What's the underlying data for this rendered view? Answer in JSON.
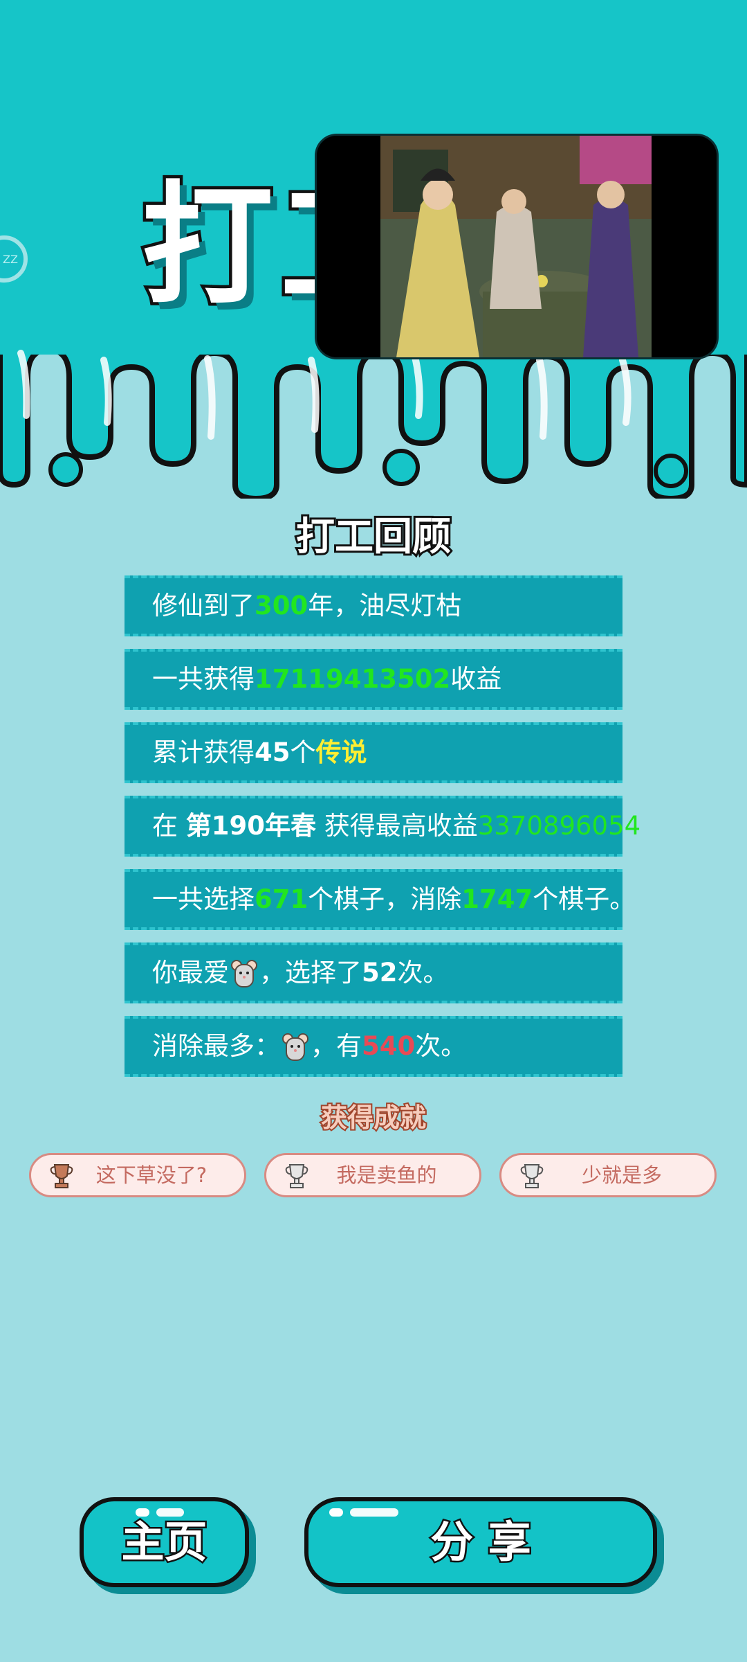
{
  "header": {
    "big_title": "打工",
    "side_bubble_text": "ZZ"
  },
  "review": {
    "title": "打工回顾",
    "rows": [
      {
        "pre": "修仙到了",
        "value": "300",
        "post": "年，油尽灯枯"
      },
      {
        "pre": "一共获得",
        "value": "17119413502",
        "post": "收益"
      },
      {
        "pre": "累计获得",
        "value": "45",
        "mid": "个",
        "highlight": "传说"
      },
      {
        "pre": "在 ",
        "bold": "第190年春",
        "mid": " 获得最高收益",
        "value": "3370896054"
      },
      {
        "pre": "一共选择",
        "value": "671",
        "mid": "个棋子，消除",
        "value2": "1747",
        "post": "个棋子。"
      },
      {
        "pre": "你最爱",
        "icon": "mouse-icon",
        "mid": "，选择了",
        "value": "52",
        "post": "次。"
      },
      {
        "pre": "消除最多：",
        "icon": "mouse-icon",
        "mid": "，有",
        "value": "540",
        "post": "次。"
      }
    ]
  },
  "achievements": {
    "title": "获得成就",
    "badges": [
      {
        "label": "这下草没了?",
        "icon": "trophy-icon-bronze"
      },
      {
        "label": "我是卖鱼的",
        "icon": "trophy-icon-silver"
      },
      {
        "label": "少就是多",
        "icon": "trophy-icon-silver"
      }
    ]
  },
  "buttons": {
    "home": "主页",
    "share": "分 享"
  },
  "colors": {
    "background": "#9edde3",
    "teal": "#16c5c8",
    "row_bg": "#0fa1b0",
    "green_highlight": "#22e61f",
    "yellow_highlight": "#ffee33",
    "red_highlight": "#e84a55"
  }
}
